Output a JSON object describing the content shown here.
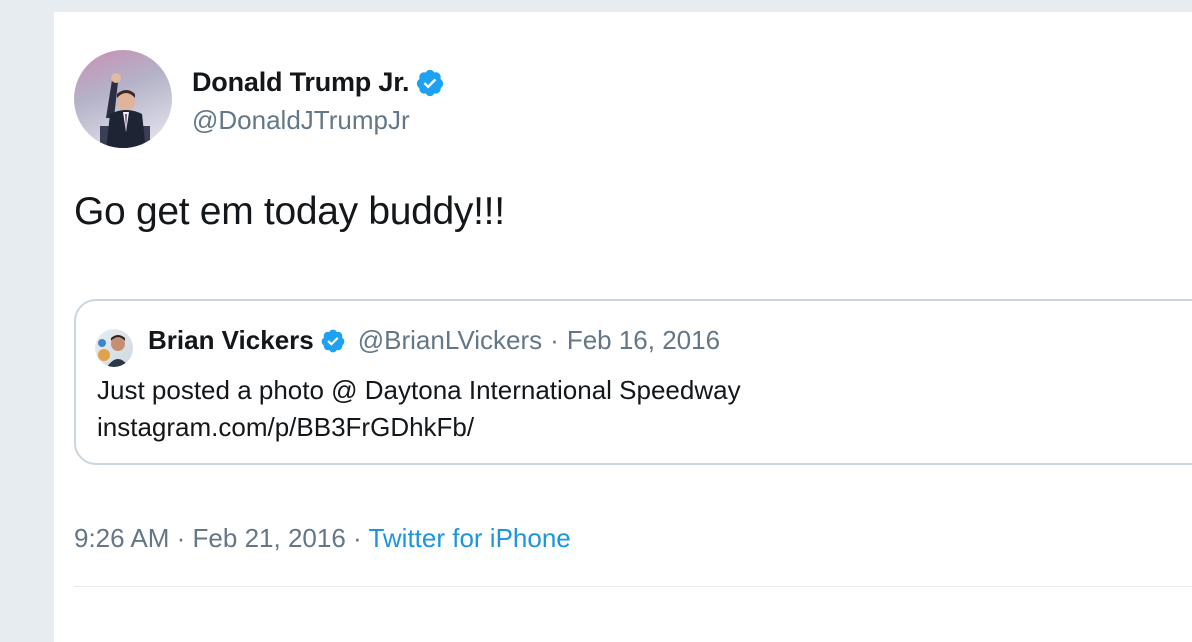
{
  "tweet": {
    "author_name": "Donald Trump Jr.",
    "author_handle": "@DonaldJTrumpJr",
    "text": "Go get em today buddy!!!",
    "time": "9:26 AM",
    "date": "Feb 21, 2016",
    "separator": "·",
    "source": "Twitter for iPhone"
  },
  "quoted": {
    "author_name": "Brian Vickers",
    "author_handle": "@BrianLVickers",
    "separator": "·",
    "date": "Feb 16, 2016",
    "text_line1": "Just posted a photo @ Daytona International Speedway",
    "text_line2": "instagram.com/p/BB3FrGDhkFb/"
  },
  "icons": {
    "verified": "verified-badge-icon"
  },
  "colors": {
    "verified_blue": "#1da1f2",
    "link_blue": "#1b95e0",
    "secondary_text": "#657786",
    "primary_text": "#14171a",
    "border": "#ccd6dd",
    "page_background": "#e6ecf0"
  }
}
